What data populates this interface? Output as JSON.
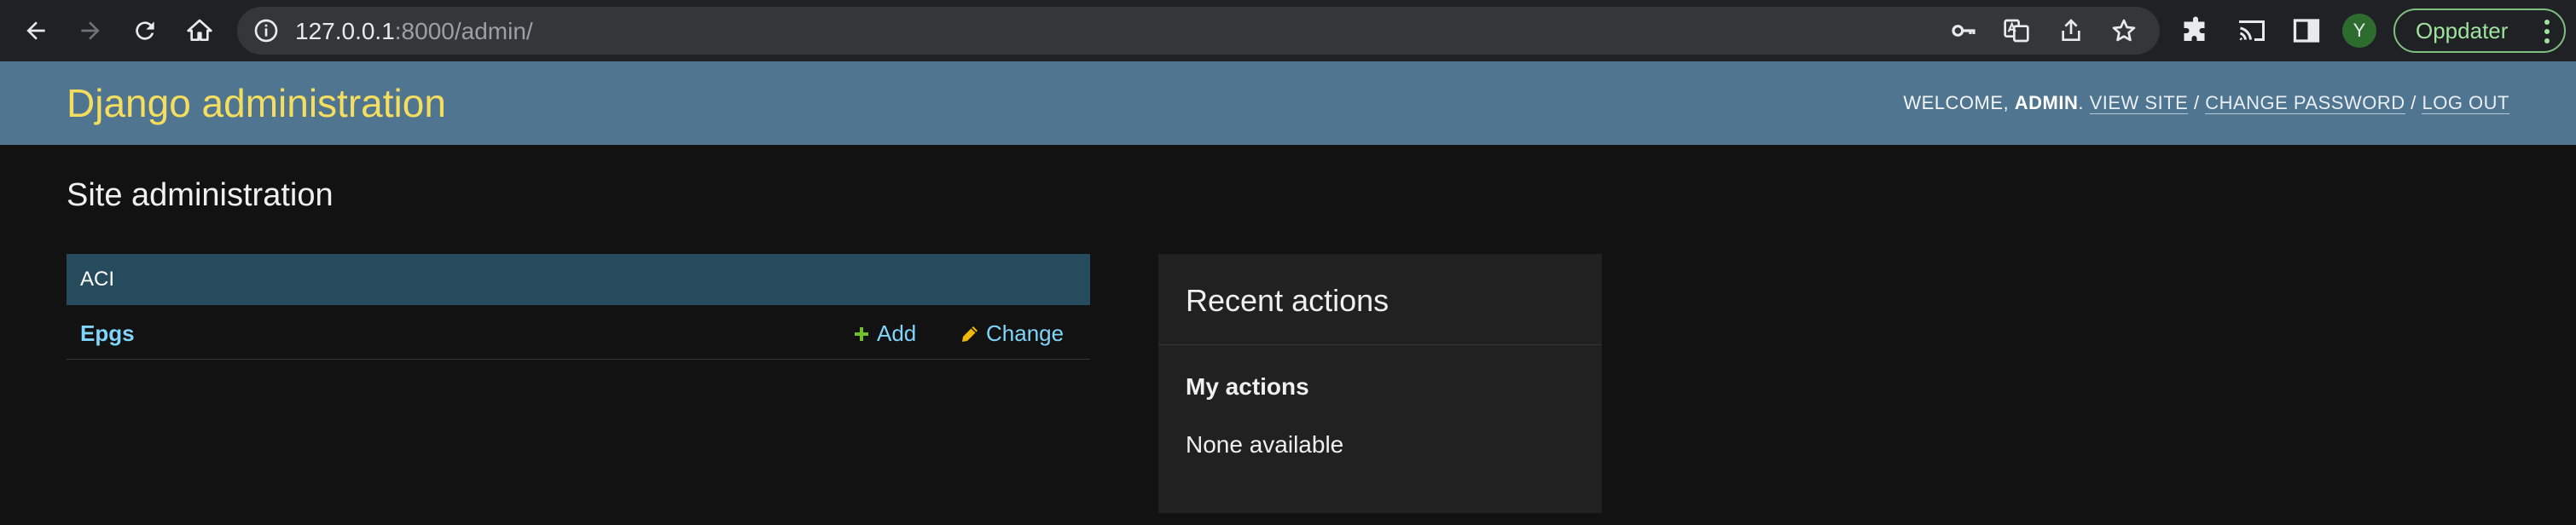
{
  "browser": {
    "url_host": "127.0.0.1",
    "url_rest": ":8000/admin/",
    "profile_initial": "Y",
    "update_label": "Oppdater",
    "icons": [
      "back-arrow-icon",
      "forward-arrow-icon",
      "reload-icon",
      "home-icon",
      "info-icon",
      "key-icon",
      "translate-icon",
      "share-icon",
      "star-icon",
      "extensions-icon",
      "cast-icon",
      "side-panel-icon",
      "more-vertical-icon"
    ]
  },
  "header": {
    "brand": "Django administration",
    "welcome": "WELCOME, ",
    "username": "ADMIN",
    "period": ". ",
    "view_site": "VIEW SITE",
    "sep1": " / ",
    "change_password": "CHANGE PASSWORD",
    "sep2": " / ",
    "log_out": "LOG OUT"
  },
  "main": {
    "title": "Site administration",
    "apps": [
      {
        "caption": "ACI",
        "models": [
          {
            "name": "Epgs",
            "add_label": "Add",
            "change_label": "Change"
          }
        ]
      }
    ]
  },
  "recent_actions": {
    "title": "Recent actions",
    "my_actions": "My actions",
    "empty": "None available"
  },
  "colors": {
    "header_bg": "#4f7591",
    "brand": "#f5dd5d",
    "caption_bg": "#264b5d",
    "link": "#81d4fa",
    "add_icon": "#70bf2b",
    "change_icon": "#efb80b",
    "page_bg": "#121212"
  }
}
